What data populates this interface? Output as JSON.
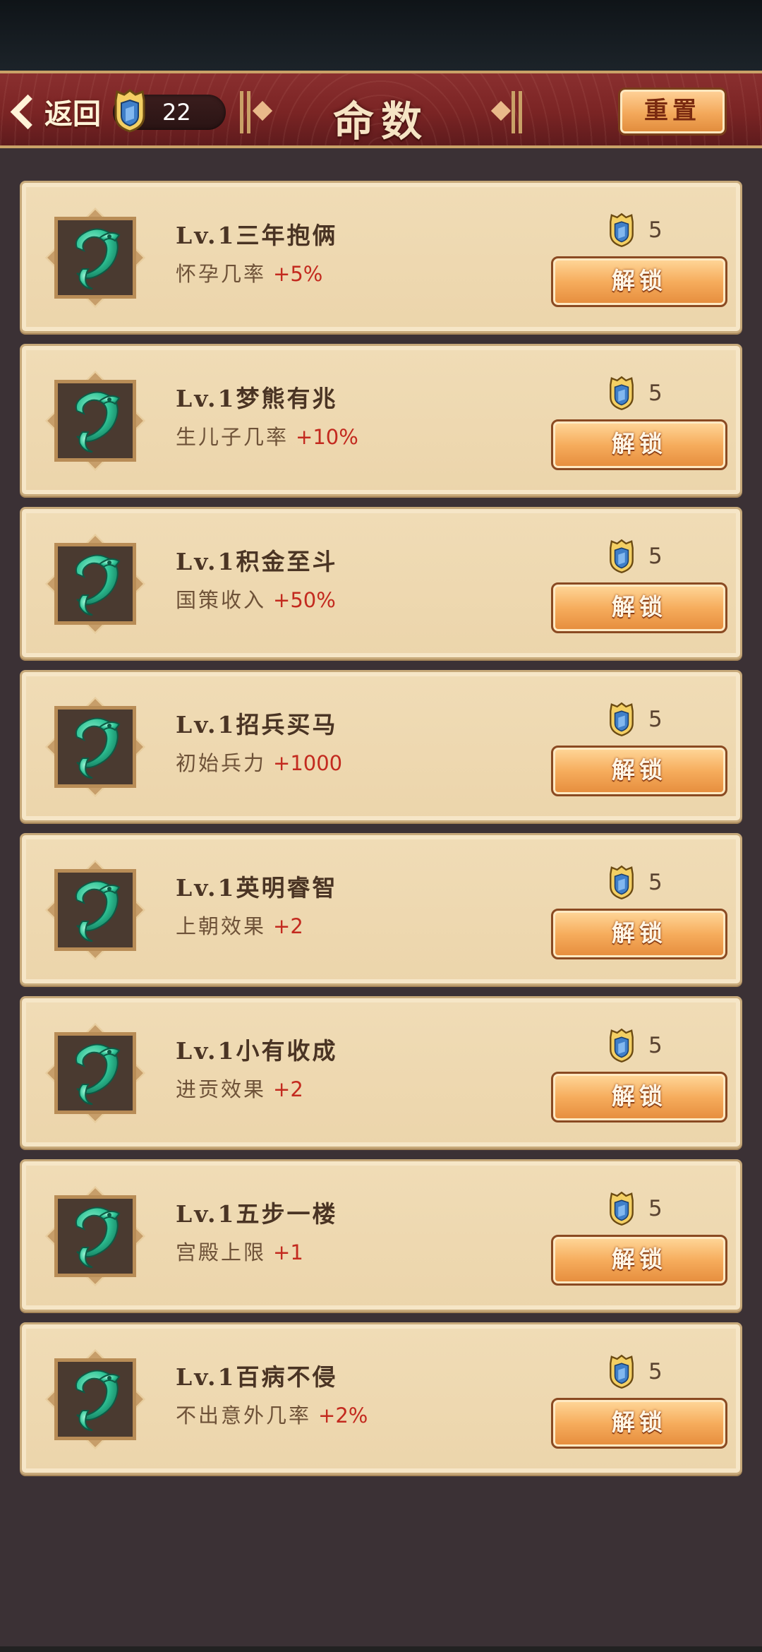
{
  "header": {
    "back_label": "返回",
    "points": "22",
    "title": "命数",
    "reset_label": "重置"
  },
  "icons": {
    "points_badge": "shield-badge-icon",
    "card_icon": "jade-dragon-icon"
  },
  "colors": {
    "header_red": "#7a2424",
    "card_bg": "#ecd5ab",
    "bonus_red": "#c32a1f",
    "button_orange": "#f6ad5d"
  },
  "cards": [
    {
      "name": "Lv.1三年抱俩",
      "effect": "怀孕几率",
      "bonus": "+5%",
      "cost": "5",
      "button": "解锁"
    },
    {
      "name": "Lv.1梦熊有兆",
      "effect": "生儿子几率",
      "bonus": "+10%",
      "cost": "5",
      "button": "解锁"
    },
    {
      "name": "Lv.1积金至斗",
      "effect": "国策收入",
      "bonus": "+50%",
      "cost": "5",
      "button": "解锁"
    },
    {
      "name": "Lv.1招兵买马",
      "effect": "初始兵力",
      "bonus": "+1000",
      "cost": "5",
      "button": "解锁"
    },
    {
      "name": "Lv.1英明睿智",
      "effect": "上朝效果",
      "bonus": "+2",
      "cost": "5",
      "button": "解锁"
    },
    {
      "name": "Lv.1小有收成",
      "effect": "进贡效果",
      "bonus": "+2",
      "cost": "5",
      "button": "解锁"
    },
    {
      "name": "Lv.1五步一楼",
      "effect": "宫殿上限",
      "bonus": "+1",
      "cost": "5",
      "button": "解锁"
    },
    {
      "name": "Lv.1百病不侵",
      "effect": "不出意外几率",
      "bonus": "+2%",
      "cost": "5",
      "button": "解锁"
    }
  ]
}
